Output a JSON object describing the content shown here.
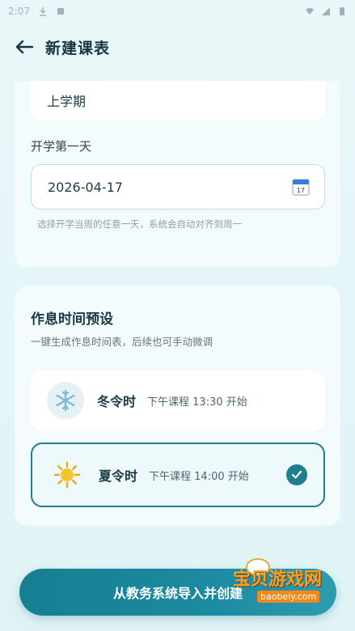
{
  "status_bar": {
    "time": "2:07"
  },
  "header": {
    "title": "新建课表"
  },
  "semester": {
    "value": "上学期"
  },
  "start_day": {
    "label": "开学第一天",
    "date": "2026-04-17",
    "calendar_day": "17",
    "hint": "选择开学当周的任意一天，系统会自动对齐到周一"
  },
  "schedule_preset": {
    "title": "作息时间预设",
    "subtitle": "一键生成作息时间表，后续也可手动微调",
    "options": [
      {
        "name": "冬令时",
        "desc": "下午课程 13:30 开始",
        "icon": "snowflake-icon",
        "selected": false
      },
      {
        "name": "夏令时",
        "desc": "下午课程 14:00 开始",
        "icon": "sun-icon",
        "selected": true
      }
    ]
  },
  "import_button": {
    "label": "从教务系统导入并创建"
  },
  "watermark": {
    "text": "宝贝游戏网",
    "url": "baobeiy.com"
  },
  "colors": {
    "accent": "#1f7f8e",
    "background": "#e3f5f7"
  }
}
